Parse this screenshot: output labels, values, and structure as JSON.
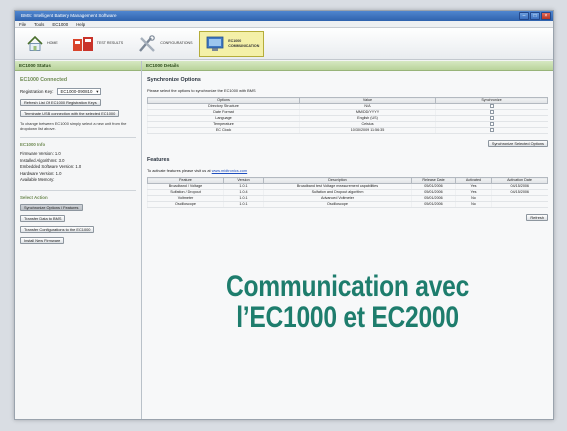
{
  "window": {
    "title": "BMS: Intelligent Battery Management Software"
  },
  "menu": [
    "File",
    "Tools",
    "EC1000",
    "Help"
  ],
  "toolbar": {
    "buttons": [
      {
        "label": "Home",
        "icon": "home-icon"
      },
      {
        "label": "Test Results",
        "icon": "test-results-icon"
      },
      {
        "label": "Configurations",
        "icon": "configurations-icon"
      },
      {
        "label": "EC1000 Communication",
        "icon": "communication-icon",
        "active": true
      }
    ]
  },
  "left_panel": {
    "header": "EC1000 Status",
    "heading": "EC1000 Connected",
    "registration_label": "Registration Key:",
    "registration_value": "EC1000-090810",
    "refresh_button": "Refresh List Of EC1000 Registration Keys",
    "terminate_button": "Terminate USB connection with the selected EC1000",
    "note": "To change between EC1000 simply select a new unit from the dropdown list above.",
    "info_heading": "EC1000 Info",
    "info": [
      "Firmware Version: 1.0",
      "Installed Algorithms: 3.0",
      "Embedded Software Version: 1.0",
      "Hardware Version: 1.0",
      "Available Memory:"
    ],
    "actions_heading": "Select Action",
    "actions": [
      "Synchronize Options / Features",
      "Transfer Data to BMS",
      "Transfer Configurations to the EC1000",
      "Install New Firmware"
    ]
  },
  "right_panel": {
    "header": "EC1000 Details",
    "sync": {
      "heading": "Synchronize Options",
      "description": "Please select the options to synchronize the EC1000 with BMS",
      "columns": [
        "Options",
        "Value",
        "Synchronize"
      ],
      "rows": [
        [
          "Directory Structure",
          "N/A"
        ],
        [
          "Date Format",
          "MM/DD/YYYY"
        ],
        [
          "Language",
          "English (US)"
        ],
        [
          "Temperature",
          "Celsius"
        ],
        [
          "EC Clock",
          "10/30/2009 11:56:35"
        ]
      ],
      "button": "Synchronize Selected Options"
    },
    "features": {
      "heading": "Features",
      "description_prefix": "To activate features please visit us at",
      "link": "www.midtronics.com",
      "columns": [
        "Feature",
        "Version",
        "Description",
        "Release Date",
        "Activated",
        "Activation Date"
      ],
      "rows": [
        [
          "Broadband / Voltage",
          "1.0.1",
          "Broadband test Voltage measurement capabilities",
          "05/01/2006",
          "Yes",
          "04/15/2006"
        ],
        [
          "Sulfation / Dropout",
          "1.0.4",
          "Sulfation and Dropout algorithm",
          "05/01/2006",
          "Yes",
          "04/15/2006"
        ],
        [
          "Voltmeter",
          "1.0.1",
          "Advanced Voltmeter",
          "05/01/2006",
          "No",
          ""
        ],
        [
          "Oscilloscope",
          "1.0.1",
          "Oscilloscope",
          "05/01/2006",
          "No",
          ""
        ]
      ],
      "button": "Refresh"
    }
  },
  "overlay": {
    "line1": "Communication avec",
    "line2": "l’EC1000 et EC2000",
    "color": "#1e7d6d"
  }
}
